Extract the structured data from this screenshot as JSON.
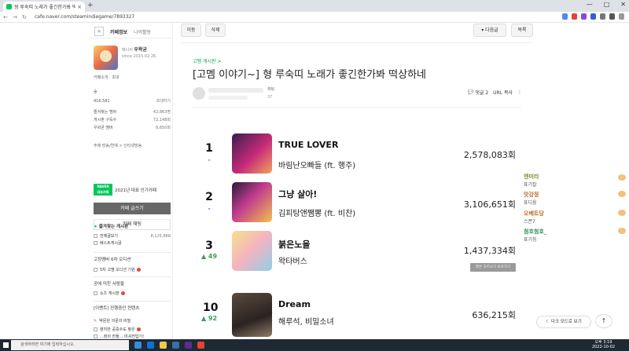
{
  "browser": {
    "tab_title": "형 루숙띠 노래가 좋긴한가봐 떡...",
    "url": "cafe.naver.com/steamindiegame/7893327"
  },
  "sidebar": {
    "tab_cafe_info": "카페정보",
    "tab_my_activity": "나의활동",
    "grade": "매니저",
    "cafe_name": "우왁굳",
    "since": "since 2015.02.26.",
    "cafe_intro": "카페소개",
    "invite": "초대",
    "level": "숲",
    "members": "416,581",
    "members_label": "초대하기",
    "stats": [
      {
        "label": "즐겨찾는 멤버",
        "value": "42,863명"
      },
      {
        "label": "게시판 구독수",
        "value": "72,148회"
      },
      {
        "label": "우왁굳 멤버",
        "value": "6,650회"
      }
    ],
    "theme": "주제 방송/연예 > 인터넷방송",
    "badge_top": "NAVER",
    "badge_bottom": "대표카페",
    "badge_text": "2021년 대표 인기카페",
    "write_label": "카페 글쓰기",
    "chat_label": "카페 채팅",
    "fav_boards_title": "즐겨찾는 게시판",
    "fav_boards": [
      {
        "label": "전체글보기",
        "count": "8,125,868"
      },
      {
        "label": "베스트게시글",
        "count": ""
      }
    ],
    "section_title": "고정멤버 6차 오디션",
    "section_item": "5차 고멤 오디션 기원",
    "section2_title": "공에 미친 사람들",
    "section2_item": "쇼츠 게시판",
    "section3_title": "[이벤트] 진행중인 컨텐츠",
    "section3_item": "박문원 의문의 비밀",
    "section3_item2": "왠지만 공중수도 찾은",
    "section3_item3": "...창의 한들... 미셔전입기!"
  },
  "actions": {
    "edit": "이동",
    "delete": "삭제",
    "next_post": "다음글",
    "list": "목록"
  },
  "article": {
    "board_link": "고멤 게시판 >",
    "title": "[고멤 이야기~] 형 루숙띠 노래가 좋긴한가봐 떡상하네",
    "author_tag": "채팅",
    "date": "37",
    "comments": "댓글 2",
    "url_copy": "URL 복사",
    "ad_chip": "멜론 차트보기 바로가기"
  },
  "chart_data": {
    "type": "table",
    "columns": [
      "rank",
      "change",
      "title",
      "artist",
      "plays"
    ],
    "rows": [
      {
        "rank": "1",
        "change": "-",
        "title": "TRUE LOVER",
        "artist": "바림난오빠들 (ft. 행주)",
        "plays": "2,578,083회"
      },
      {
        "rank": "2",
        "change": "-",
        "title": "그냥 살아!",
        "artist": "김피탕앤쨈뽕 (ft. 비찬)",
        "plays": "3,106,651회"
      },
      {
        "rank": "3",
        "change": "▲ 49",
        "title": "붉은노을",
        "artist": "왁타버스",
        "plays": "1,437,334회"
      },
      {
        "rank": "10",
        "change": "▲ 92",
        "title": "Dream",
        "artist": "해루석, 비밀소녀",
        "plays": "636,215회"
      }
    ]
  },
  "chat": [
    {
      "name": "엔미리",
      "msg": "표기칼",
      "color": "#6f8f2f"
    },
    {
      "name": "맛강정",
      "msg": "표디움",
      "color": "#b96a24"
    },
    {
      "name": "오베트당",
      "msg": "스폰7",
      "color": "#b96a24"
    },
    {
      "name": "첨호첨호_",
      "msg": "표기칭",
      "color": "#2f8f58"
    }
  ],
  "floating": {
    "dark_mode": "다크 모드로 보기",
    "top": "↑"
  },
  "taskbar": {
    "search_placeholder": "검색하려면 여기에 입력하십시오.",
    "time": "오후 3:19",
    "date": "2022-10-02"
  }
}
